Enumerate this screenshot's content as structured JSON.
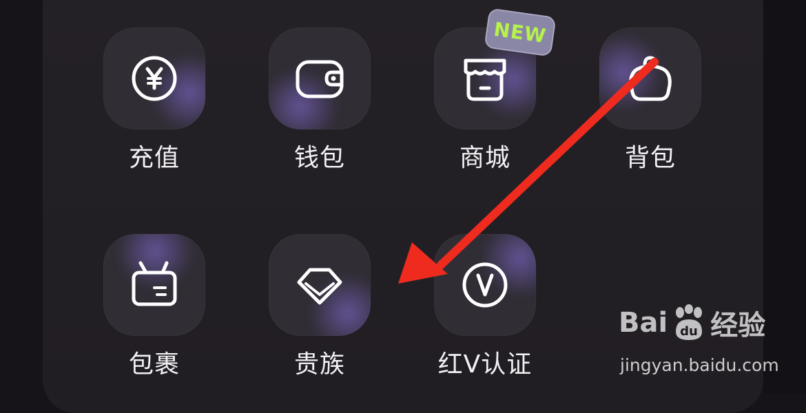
{
  "menu": {
    "items": [
      {
        "label": "充值",
        "icon": "recharge-yen-icon"
      },
      {
        "label": "钱包",
        "icon": "wallet-icon"
      },
      {
        "label": "商城",
        "icon": "store-icon"
      },
      {
        "label": "背包",
        "icon": "backpack-icon"
      },
      {
        "label": "包裹",
        "icon": "package-icon"
      },
      {
        "label": "贵族",
        "icon": "diamond-icon"
      },
      {
        "label": "红V认证",
        "icon": "v-badge-icon"
      }
    ],
    "new_badge": "NEW"
  },
  "watermark": {
    "brand": "Bai",
    "paw": "du",
    "suffix": "经验",
    "url": "jingyan.baidu.com"
  },
  "colors": {
    "background": "#171419",
    "panel": "#242126",
    "tile": "#312d35",
    "glow": "#7e67c8",
    "arrow": "#ee2b1e",
    "new_text": "#b6f24d",
    "new_badge_bg": "#8a86a6"
  }
}
